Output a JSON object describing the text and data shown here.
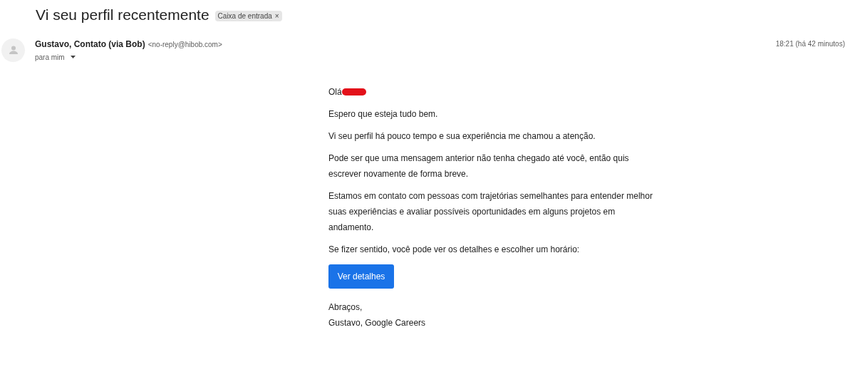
{
  "subject": "Vi seu perfil recentemente",
  "label": {
    "text": "Caixa de entrada",
    "close": "×"
  },
  "sender": {
    "name": "Gustavo, Contato (via Bob)",
    "email": "<no-reply@hibob.com>",
    "recipient": "para mim"
  },
  "time": "18:21 (há 42 minutos)",
  "body": {
    "greeting": "Olá",
    "greeting_redacted": true,
    "paragraphs": [
      "Espero que esteja tudo bem.",
      "Vi seu perfil há pouco tempo e sua experiência me chamou a atenção.",
      "Pode ser que uma mensagem anterior não tenha chegado até você, então quis escrever novamente de forma breve.",
      "Estamos em contato com pessoas com trajetórias semelhantes para entender melhor suas experiências e avaliar possíveis oportunidades em alguns projetos em andamento.",
      "Se fizer sentido, você pode ver os detalhes e escolher um horário:"
    ],
    "button": "Ver detalhes",
    "closing": "Abraços,",
    "signature": "Gustavo, Google Careers"
  }
}
